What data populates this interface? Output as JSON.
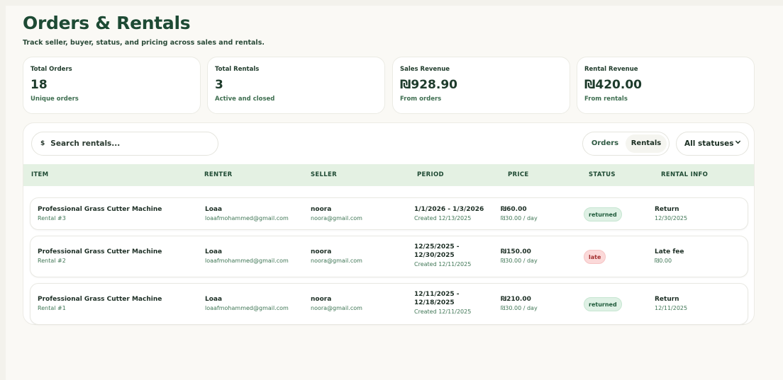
{
  "header": {
    "title": "Orders & Rentals",
    "subtitle": "Track seller, buyer, status, and pricing across sales and rentals."
  },
  "stats": [
    {
      "label": "Total Orders",
      "value": "18",
      "note": "Unique orders"
    },
    {
      "label": "Total Rentals",
      "value": "3",
      "note": "Active and closed"
    },
    {
      "label": "Sales Revenue",
      "value": "₪928.90",
      "note": "From orders"
    },
    {
      "label": "Rental Revenue",
      "value": "₪420.00",
      "note": "From rentals"
    }
  ],
  "toolbar": {
    "search_icon": "$",
    "search_placeholder": "Search rentals...",
    "tabs": [
      {
        "label": "Orders",
        "active": false
      },
      {
        "label": "Rentals",
        "active": true
      }
    ],
    "status_filter": "All statuses",
    "chevron_icon": "chevron-down-icon"
  },
  "table": {
    "columns": [
      "ITEM",
      "RENTER",
      "SELLER",
      "PERIOD",
      "PRICE",
      "STATUS",
      "RENTAL INFO"
    ],
    "rows": [
      {
        "item": "Professional Grass Cutter Machine",
        "item_sub": "Rental #3",
        "renter": "Loaa",
        "renter_email": "loaafmohammed@gmail.com",
        "seller": "noora",
        "seller_email": "noora@gmail.com",
        "period_line1": "1/1/2026 - 1/3/2026",
        "period_line2": "",
        "period_created": "Created 12/13/2025",
        "price": "₪60.00",
        "price_rate": "₪30.00 / day",
        "status": "returned",
        "info_label": "Return",
        "info_value": "12/30/2025"
      },
      {
        "item": "Professional Grass Cutter Machine",
        "item_sub": "Rental #2",
        "renter": "Loaa",
        "renter_email": "loaafmohammed@gmail.com",
        "seller": "noora",
        "seller_email": "noora@gmail.com",
        "period_line1": "12/25/2025 -",
        "period_line2": "12/30/2025",
        "period_created": "Created 12/11/2025",
        "price": "₪150.00",
        "price_rate": "₪30.00 / day",
        "status": "late",
        "info_label": "Late fee",
        "info_value": "₪0.00"
      },
      {
        "item": "Professional Grass Cutter Machine",
        "item_sub": "Rental #1",
        "renter": "Loaa",
        "renter_email": "loaafmohammed@gmail.com",
        "seller": "noora",
        "seller_email": "noora@gmail.com",
        "period_line1": "12/11/2025 -",
        "period_line2": "12/18/2025",
        "period_created": "Created 12/11/2025",
        "price": "₪210.00",
        "price_rate": "₪30.00 / day",
        "status": "returned",
        "info_label": "Return",
        "info_value": "12/11/2025"
      }
    ]
  },
  "colors": {
    "brand_dark": "#1d4a34",
    "header_bg": "#e4f1e3",
    "returned_bg": "#dff1e5",
    "late_bg": "#fbd9d9"
  }
}
